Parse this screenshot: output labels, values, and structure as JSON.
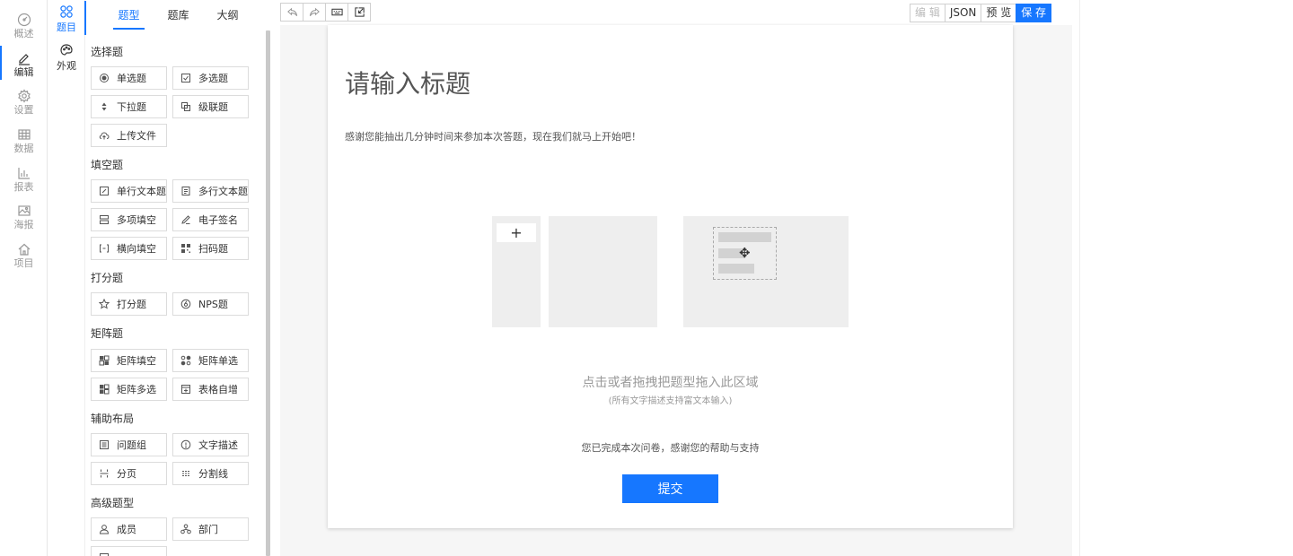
{
  "nav": {
    "items": [
      {
        "label": "概述",
        "icon": "dashboard-icon"
      },
      {
        "label": "编辑",
        "icon": "edit-icon"
      },
      {
        "label": "设置",
        "icon": "gear-icon"
      },
      {
        "label": "数据",
        "icon": "table-icon"
      },
      {
        "label": "报表",
        "icon": "bar-chart-icon"
      },
      {
        "label": "海报",
        "icon": "image-icon"
      },
      {
        "label": "项目",
        "icon": "home-icon"
      }
    ]
  },
  "sub": {
    "items": [
      {
        "label": "题目",
        "icon": "question-icon"
      },
      {
        "label": "外观",
        "icon": "palette-icon"
      }
    ]
  },
  "panel": {
    "tabs": [
      "题型",
      "题库",
      "大纲"
    ],
    "groups": [
      {
        "title": "选择题",
        "items": [
          "单选题",
          "多选题",
          "下拉题",
          "级联题",
          "上传文件"
        ]
      },
      {
        "title": "填空题",
        "items": [
          "单行文本题",
          "多行文本题",
          "多项填空",
          "电子签名",
          "横向填空",
          "扫码题"
        ]
      },
      {
        "title": "打分题",
        "items": [
          "打分题",
          "NPS题"
        ]
      },
      {
        "title": "矩阵题",
        "items": [
          "矩阵填空",
          "矩阵单选",
          "矩阵多选",
          "表格自增"
        ]
      },
      {
        "title": "辅助布局",
        "items": [
          "问题组",
          "文字描述",
          "分页",
          "分割线"
        ]
      },
      {
        "title": "高级题型",
        "items": [
          "成员",
          "部门",
          ""
        ]
      }
    ]
  },
  "toolbar": {
    "actions": {
      "edit": "编 辑",
      "json": "JSON",
      "preview": "预 览",
      "save": "保 存"
    }
  },
  "survey": {
    "title": "请输入标题",
    "description": "感谢您能抽出几分钟时间来参加本次答题，现在我们就马上开始吧！",
    "drop_hint": "点击或者拖拽把题型拖入此区域",
    "drop_sub": "(所有文字描述支持富文本输入)",
    "finish_text": "您已完成本次问卷，感谢您的帮助与支持",
    "submit_label": "提交"
  },
  "colors": {
    "accent": "#1677ff",
    "canvas": "#f6f6f6",
    "placeholder": "#eeeeee"
  }
}
